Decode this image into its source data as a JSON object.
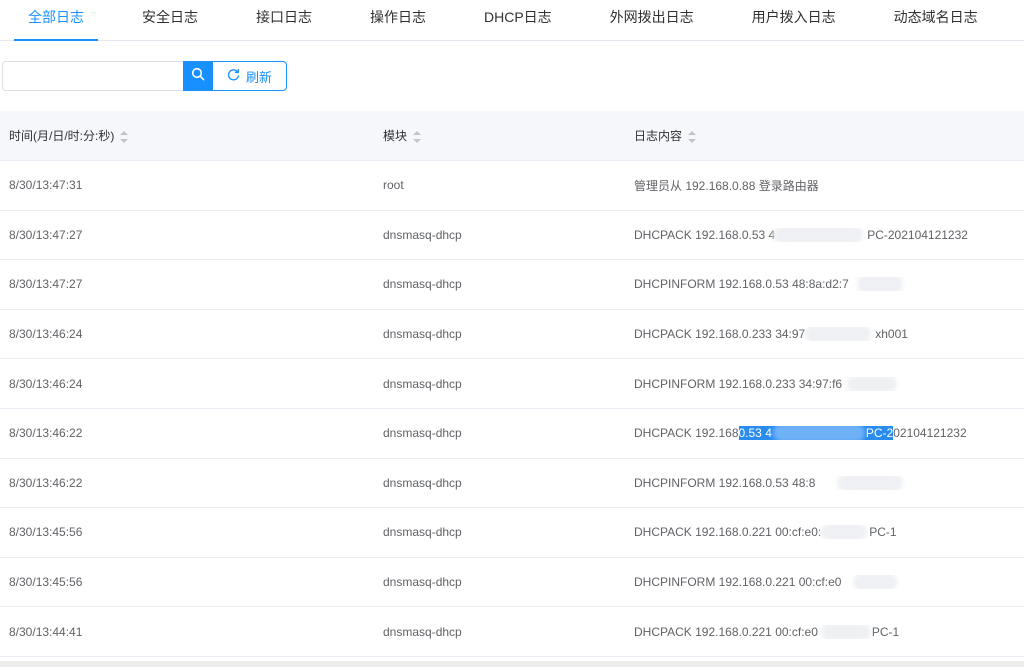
{
  "tabs": [
    "全部日志",
    "安全日志",
    "接口日志",
    "操作日志",
    "DHCP日志",
    "外网拨出日志",
    "用户拨入日志",
    "动态域名日志"
  ],
  "toolbar": {
    "search_value": "",
    "search_placeholder": "",
    "refresh_label": "刷新"
  },
  "table": {
    "headers": [
      "时间(月/日/时:分:秒)",
      "模块",
      "日志内容"
    ],
    "rows": [
      {
        "time": "8/30/13:47:31",
        "module": "root",
        "content": "管理员从 192.168.0.88 登录路由器"
      },
      {
        "time": "8/30/13:47:27",
        "module": "dnsmasq-dhcp",
        "content_a": "DHCPACK 192.168.0.53 4",
        "content_b": "PC-202104121232"
      },
      {
        "time": "8/30/13:47:27",
        "module": "dnsmasq-dhcp",
        "content": "DHCPINFORM 192.168.0.53 48:8a:d2:7"
      },
      {
        "time": "8/30/13:46:24",
        "module": "dnsmasq-dhcp",
        "content_a": "DHCPACK 192.168.0.233 34:97",
        "content_b": "xh001"
      },
      {
        "time": "8/30/13:46:24",
        "module": "dnsmasq-dhcp",
        "content": "DHCPINFORM 192.168.0.233 34:97:f6"
      },
      {
        "time": "8/30/13:46:22",
        "module": "dnsmasq-dhcp",
        "content_a": "DHCPACK 192.168",
        "content_sel_a": "0.53 4",
        "content_sel_b": "PC-2",
        "content_b": "02104121232"
      },
      {
        "time": "8/30/13:46:22",
        "module": "dnsmasq-dhcp",
        "content": "DHCPINFORM 192.168.0.53 48:8"
      },
      {
        "time": "8/30/13:45:56",
        "module": "dnsmasq-dhcp",
        "content_a": "DHCPACK 192.168.0.221 00:cf:e0:",
        "content_b": "PC-1"
      },
      {
        "time": "8/30/13:45:56",
        "module": "dnsmasq-dhcp",
        "content": "DHCPINFORM 192.168.0.221 00:cf:e0"
      },
      {
        "time": "8/30/13:44:41",
        "module": "dnsmasq-dhcp",
        "content_a": "DHCPACK 192.168.0.221 00:cf:e0",
        "content_b": "PC-1"
      }
    ]
  },
  "colors": {
    "accent": "#1890ff",
    "selection": "#2b8cf0",
    "header_bg": "#f5f7fa"
  },
  "icons": {
    "search": "search-icon",
    "refresh": "refresh-icon",
    "sort": "sort-caret-icon"
  }
}
